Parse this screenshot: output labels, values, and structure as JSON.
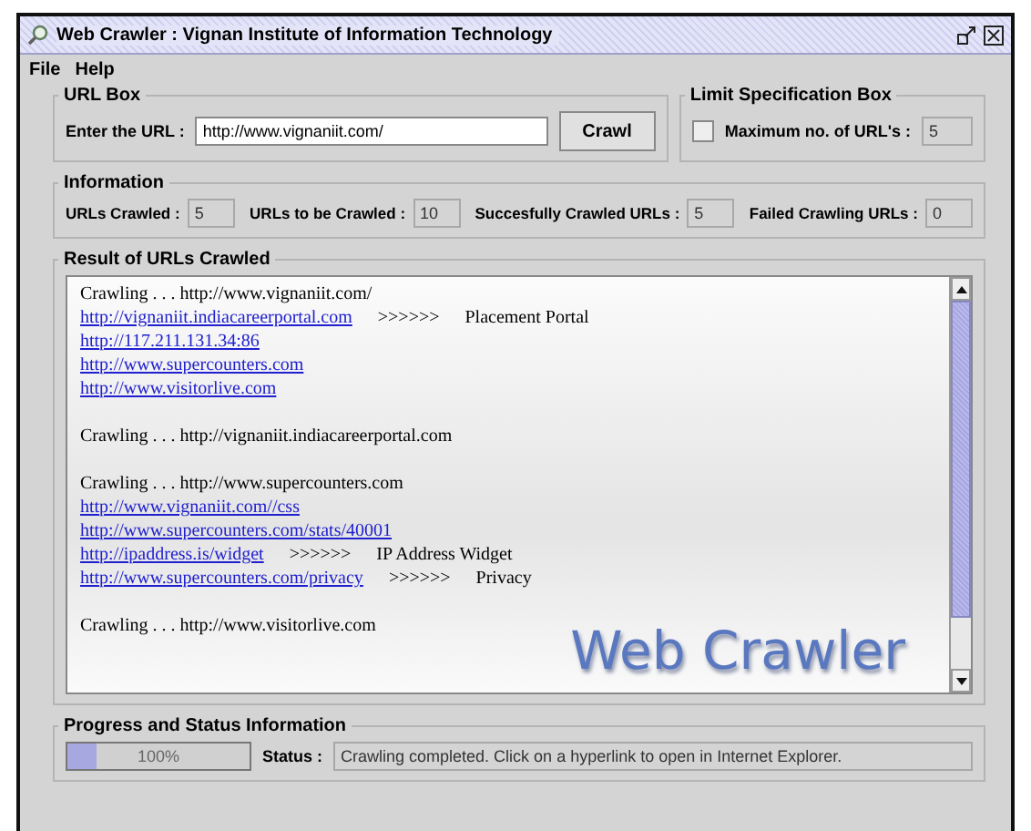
{
  "window": {
    "title": "Web Crawler : Vignan Institute of Information Technology"
  },
  "menu": [
    "File",
    "Help"
  ],
  "url_box": {
    "title": "URL Box",
    "label": "Enter the URL :",
    "value": "http://www.vignaniit.com/",
    "button": "Crawl"
  },
  "limit_box": {
    "title": "Limit Specification Box",
    "checked": false,
    "label": "Maximum no. of URL's :",
    "value": "5"
  },
  "information": {
    "title": "Information",
    "fields": [
      {
        "label": "URLs Crawled :",
        "value": "5"
      },
      {
        "label": "URLs to be Crawled :",
        "value": "10"
      },
      {
        "label": "Succesfully Crawled URLs :",
        "value": "5"
      },
      {
        "label": "Failed Crawling URLs :",
        "value": "0"
      }
    ]
  },
  "results": {
    "title": "Result of URLs Crawled",
    "watermark": "Web Crawler",
    "lines": [
      {
        "kind": "text",
        "text": "Crawling . . .  http://www.vignaniit.com/"
      },
      {
        "kind": "link",
        "url": "http://vignaniit.indiacareerportal.com",
        "arrow": ">>>>>>",
        "note": "Placement Portal"
      },
      {
        "kind": "link",
        "url": "http://117.211.131.34:86"
      },
      {
        "kind": "link",
        "url": "http://www.supercounters.com"
      },
      {
        "kind": "link",
        "url": "http://www.visitorlive.com"
      },
      {
        "kind": "blank"
      },
      {
        "kind": "text",
        "text": "Crawling . . .  http://vignaniit.indiacareerportal.com"
      },
      {
        "kind": "blank"
      },
      {
        "kind": "text",
        "text": "Crawling . . .  http://www.supercounters.com"
      },
      {
        "kind": "link",
        "url": "http://www.vignaniit.com//css"
      },
      {
        "kind": "link",
        "url": "http://www.supercounters.com/stats/40001"
      },
      {
        "kind": "link",
        "url": "http://ipaddress.is/widget",
        "arrow": ">>>>>>",
        "note": "IP Address Widget"
      },
      {
        "kind": "link",
        "url": "http://www.supercounters.com/privacy",
        "arrow": ">>>>>>",
        "note": "Privacy"
      },
      {
        "kind": "blank"
      },
      {
        "kind": "text",
        "text": "Crawling . . .  http://www.visitorlive.com"
      }
    ]
  },
  "progress": {
    "title": "Progress and Status Information",
    "level": 0.16,
    "reading": "100%",
    "status_label": "Status :",
    "status": "Crawling completed.  Click on a hyperlink to open in Internet Explorer."
  }
}
